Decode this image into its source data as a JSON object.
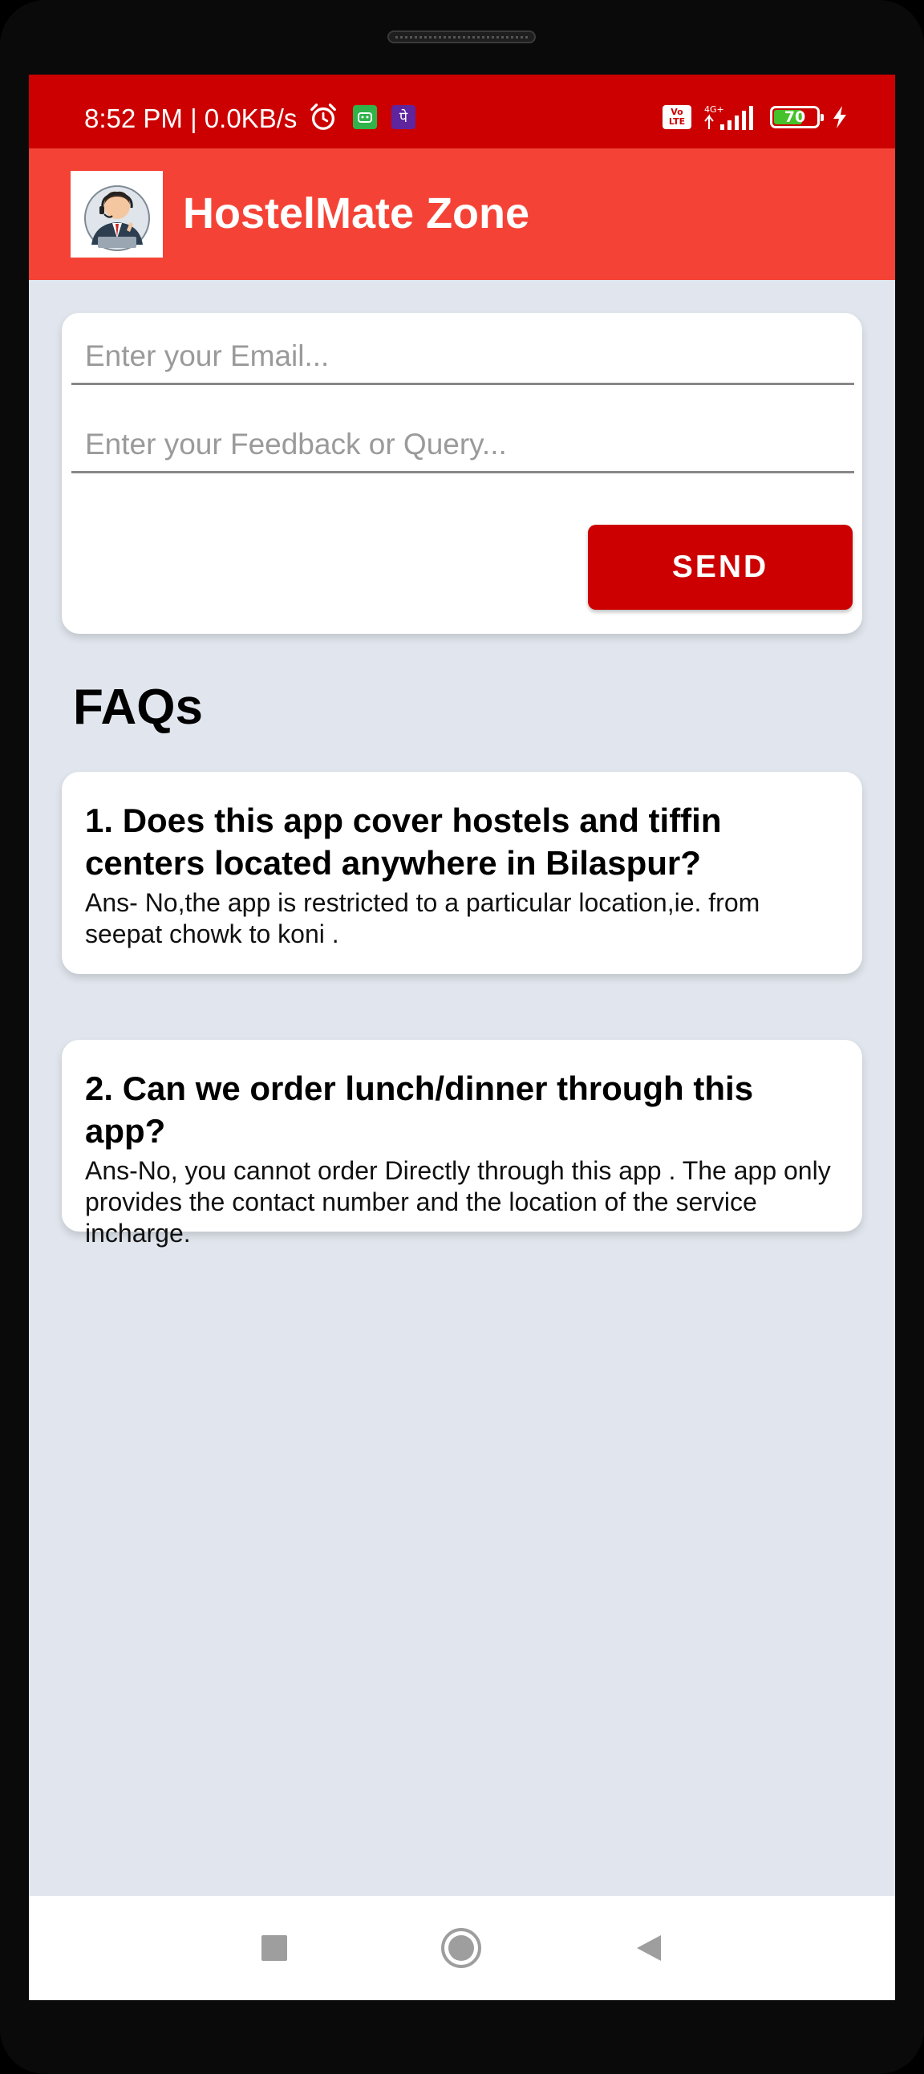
{
  "status_bar": {
    "time": "8:52 PM | 0.0KB/s",
    "network_label": "4G+",
    "volte_label": "Vo LTE",
    "battery_level": "70",
    "battery_fraction": 0.7,
    "icons": [
      "alarm-icon",
      "app-badge-green-icon",
      "phonepe-icon",
      "volte-icon",
      "signal-icon",
      "battery-icon",
      "charging-bolt-icon"
    ],
    "app_badge_purple": "पे",
    "colors": {
      "background": "#cc0000",
      "battery_fill": "#45c12a"
    }
  },
  "app_bar": {
    "title": "HostelMate Zone",
    "logo_icon": "person-at-laptop-icon",
    "background": "#f44336"
  },
  "form": {
    "email_placeholder": "Enter your Email...",
    "email_value": "",
    "feedback_placeholder": "Enter your Feedback or Query...",
    "feedback_value": "",
    "send_label": "SEND",
    "send_color": "#cc0000"
  },
  "faq": {
    "heading": "FAQs",
    "items": [
      {
        "question": "1. Does this app cover hostels and tiffin centers located anywhere in Bilaspur?",
        "answer": "Ans- No,the app is restricted to a particular location,ie. from seepat chowk to koni ."
      },
      {
        "question": "2. Can we order lunch/dinner through this app?",
        "answer": "Ans-No, you cannot order Directly through this app . The app only provides the contact number and the location of the service incharge."
      }
    ]
  },
  "nav_bar": {
    "icons": [
      "recent-apps-icon",
      "home-icon",
      "back-icon"
    ]
  }
}
